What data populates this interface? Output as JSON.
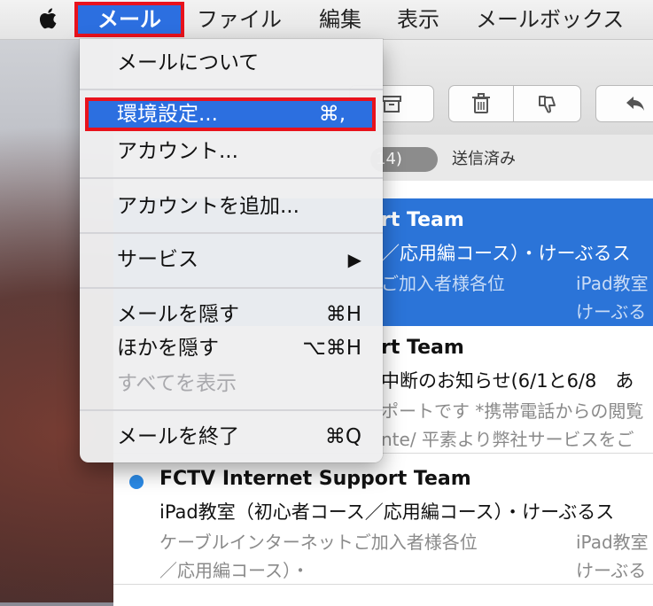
{
  "menubar": {
    "apple_icon": "apple-logo-icon",
    "items": [
      "メール",
      "ファイル",
      "編集",
      "表示",
      "メールボックス"
    ],
    "active_index": 0
  },
  "toolbar": {
    "buttons": [
      "archive-icon",
      "trash-icon",
      "junk-icon",
      "reply-icon"
    ]
  },
  "favorites": {
    "count": "14)",
    "sent": "送信済み"
  },
  "messages": [
    {
      "sender": "rt Team",
      "subject": "／応用編コース）・けーぶるス",
      "preview_left_1": "ご加入者様各位",
      "preview_left_2": "",
      "preview_right_1": "iPad教室",
      "preview_right_2": "けーぶる",
      "selected": true
    },
    {
      "sender": "rt Team",
      "subject": "中断のお知らせ(6/1と6/8　あ",
      "preview_left_1": "ポートです *携帯電話からの閲覧",
      "preview_left_2": "nte/ 平素より弊社サービスをご",
      "selected": false
    },
    {
      "sender": "FCTV Internet Support Team",
      "subject": "iPad教室（初心者コース／応用編コース）・けーぶるス",
      "preview_left_1": "ケーブルインターネットご加入者様各位",
      "preview_left_2": "／応用編コース）・",
      "preview_right_1": "iPad教室",
      "preview_right_2": "けーぶる",
      "unread": true,
      "selected": false
    }
  ],
  "dropdown": {
    "about": "メールについて",
    "preferences": "環境設定...",
    "preferences_shortcut": "⌘,",
    "accounts": "アカウント...",
    "add_account": "アカウントを追加...",
    "services": "サービス",
    "services_arrow": "▶",
    "hide_mail": "メールを隠す",
    "hide_mail_shortcut": "⌘H",
    "hide_others": "ほかを隠す",
    "hide_others_shortcut": "⌥⌘H",
    "show_all": "すべてを表示",
    "quit": "メールを終了",
    "quit_shortcut": "⌘Q"
  },
  "colors": {
    "highlight_blue": "#2c6fe0",
    "annotation_red": "#e8121c",
    "selected_row": "#2b74d8",
    "unread_dot": "#2b8ae6"
  }
}
